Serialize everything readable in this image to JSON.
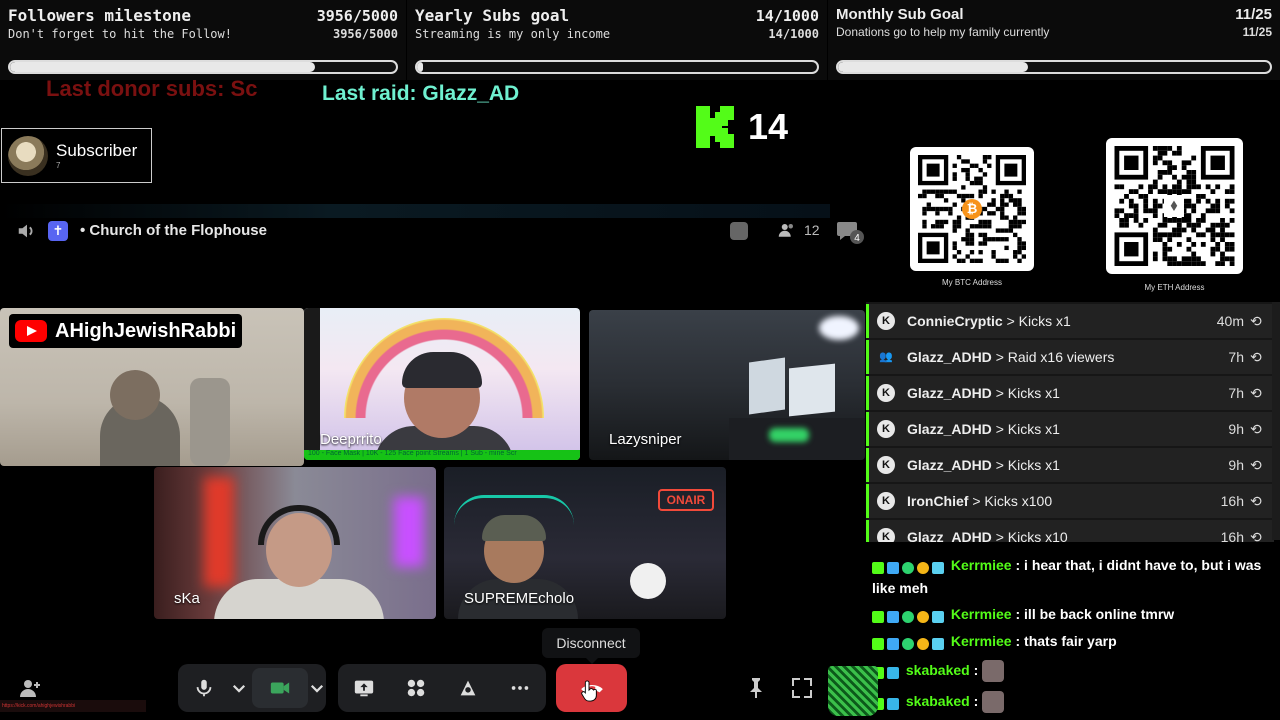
{
  "goals": [
    {
      "title": "Followers milestone",
      "count": "3956/5000",
      "subtitle": "Don't forget to hit the Follow!",
      "subcount": "3956/5000",
      "progress": 0.7912
    },
    {
      "title": "Yearly Subs goal",
      "count": "14/1000",
      "subtitle": "Streaming is my only income",
      "subcount": "14/1000",
      "progress": 0.014
    },
    {
      "title": "Monthly Sub Goal",
      "count": "11/25",
      "subtitle": "Donations go to help my family currently",
      "subcount": "11/25",
      "progress": 0.44
    }
  ],
  "overlay": {
    "last_donor": "Last donor subs: Sc",
    "last_raid": "Last raid: Glazz_AD",
    "kick_count": "14",
    "subscriber_label": "Subscriber",
    "subscriber_count": "7",
    "url_text": "https://kick.com/ahighjewishrabbi"
  },
  "channel": {
    "name": "Church of the Flophouse",
    "participants": "12",
    "chat_badge": "4"
  },
  "qr": {
    "btc_caption": "My BTC Address",
    "eth_caption": "My ETH Address"
  },
  "tiles": {
    "youtube_name": "AHighJewishRabbi",
    "tile2": "Deeprrito",
    "tile2_ticker": "100 - Face Mask | 10K - 125 Face point Streams | 1 Sub - mine Scr",
    "tile3": "Lazysniper",
    "tile4": "sKa",
    "tile5": "SUPREMEcholo",
    "tile5_sign": "ONAIR"
  },
  "events": [
    {
      "user": "ConnieCryptic",
      "action": "> Kicks x1",
      "time": "40m",
      "icon": "K"
    },
    {
      "user": "Glazz_ADHD",
      "action": "> Raid x16 viewers",
      "time": "7h",
      "icon": "raid"
    },
    {
      "user": "Glazz_ADHD",
      "action": "> Kicks x1",
      "time": "7h",
      "icon": "K"
    },
    {
      "user": "Glazz_ADHD",
      "action": "> Kicks x1",
      "time": "9h",
      "icon": "K"
    },
    {
      "user": "Glazz_ADHD",
      "action": "> Kicks x1",
      "time": "9h",
      "icon": "K"
    },
    {
      "user": "IronChief",
      "action": "> Kicks x100",
      "time": "16h",
      "icon": "K"
    },
    {
      "user": "Glazz_ADHD",
      "action": "> Kicks x10",
      "time": "16h",
      "icon": "K"
    }
  ],
  "chat": [
    {
      "user": "Kerrmiee",
      "text": ": i hear that, i didnt have to, but i was like meh"
    },
    {
      "user": "Kerrmiee",
      "text": ": ill be back online tmrw"
    },
    {
      "user": "Kerrmiee",
      "text": ": thats fair yarp"
    },
    {
      "user": "skabaked",
      "text": ":"
    },
    {
      "user": "skabaked",
      "text": ":"
    }
  ],
  "controls": {
    "disconnect_tooltip": "Disconnect"
  },
  "colors": {
    "kick_green": "#53fc18",
    "disconnect_red": "#da373c",
    "discord_blurple": "#5865f2"
  }
}
